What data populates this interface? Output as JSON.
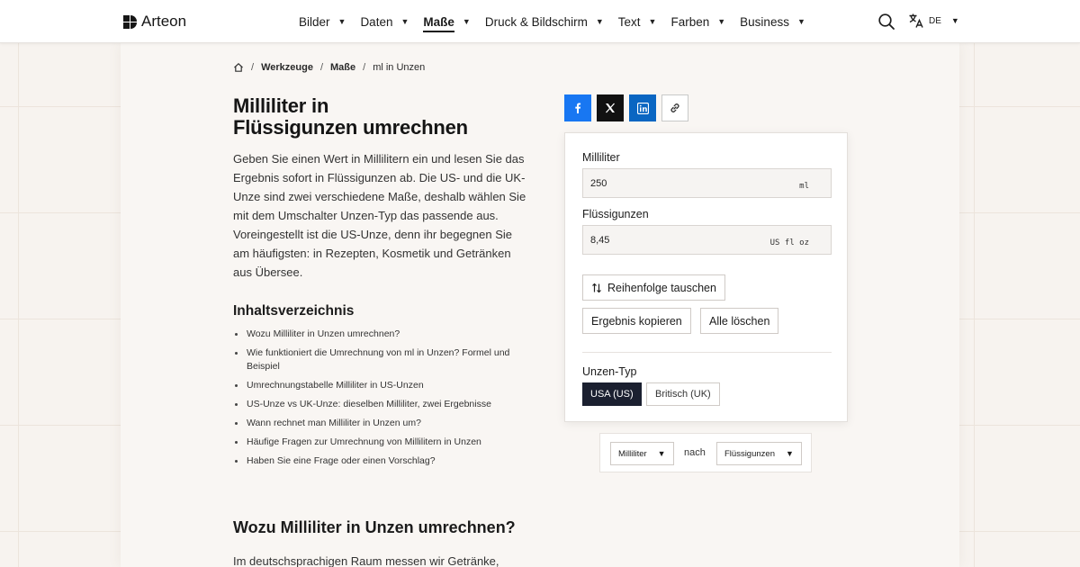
{
  "brand": {
    "name": "Arteon"
  },
  "nav": [
    {
      "label": "Bilder",
      "active": false
    },
    {
      "label": "Daten",
      "active": false
    },
    {
      "label": "Maße",
      "active": true
    },
    {
      "label": "Druck & Bildschirm",
      "active": false
    },
    {
      "label": "Text",
      "active": false
    },
    {
      "label": "Farben",
      "active": false
    },
    {
      "label": "Business",
      "active": false
    }
  ],
  "language": {
    "code": "DE"
  },
  "breadcrumb": {
    "level1": "Werkzeuge",
    "level2": "Maße",
    "current": "ml in Unzen"
  },
  "page": {
    "title_line1": "Milliliter in",
    "title_line2": "Flüssigunzen umrechnen",
    "intro": "Geben Sie einen Wert in Millilitern ein und lesen Sie das Ergebnis sofort in Flüssigunzen ab. Die US- und die UK-Unze sind zwei verschiedene Maße, deshalb wählen Sie mit dem Umschalter Unzen-Typ das passende aus. Voreingestellt ist die US-Unze, denn ihr begegnen Sie am häufigsten: in Rezepten, Kosmetik und Getränken aus Übersee."
  },
  "toc": {
    "title": "Inhaltsverzeichnis",
    "items": [
      "Wozu Milliliter in Unzen umrechnen?",
      "Wie funktioniert die Umrechnung von ml in Unzen? Formel und Beispiel",
      "Umrechnungstabelle Milliliter in US-Unzen",
      "US-Unze vs UK-Unze: dieselben Milliliter, zwei Ergebnisse",
      "Wann rechnet man Milliliter in Unzen um?",
      "Häufige Fragen zur Umrechnung von Millilitern in Unzen",
      "Haben Sie eine Frage oder einen Vorschlag?"
    ]
  },
  "section1": {
    "title": "Wozu Milliliter in Unzen umrechnen?",
    "text": "Im deutschsprachigen Raum messen wir Getränke,"
  },
  "converter": {
    "ml_label": "Milliliter",
    "ml_value": "250",
    "ml_unit": "ml",
    "oz_label": "Flüssigunzen",
    "oz_value": "8,45",
    "oz_unit": "US fl oz",
    "swap_label": "Reihenfolge tauschen",
    "copy_label": "Ergebnis kopieren",
    "clear_label": "Alle löschen",
    "type_label": "Unzen-Typ",
    "type_us": "USA (US)",
    "type_uk": "Britisch (UK)"
  },
  "pickers": {
    "from": "Milliliter",
    "connector": "nach",
    "to": "Flüssigunzen"
  },
  "icons": {
    "home": "home-icon",
    "search": "search-icon",
    "translate": "translate-icon",
    "facebook": "facebook-icon",
    "x": "x-icon",
    "linkedin": "linkedin-icon",
    "link": "link-icon",
    "swap": "swap-icon"
  },
  "colors": {
    "accent_dark": "#1b2030",
    "facebook": "#1877f2",
    "linkedin": "#0a66c2",
    "x": "#111111"
  }
}
